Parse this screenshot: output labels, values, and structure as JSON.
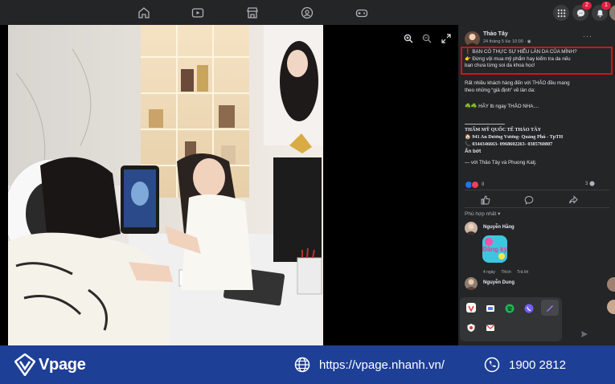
{
  "post": {
    "author": "Thảo Tây",
    "date": "24 tháng 5 lúc 10:00 · ",
    "more": "···",
    "highlight_lines": [
      "❗ BẠN CÓ THỰC SỰ HIỂU LÀN DA CỦA MÌNH?",
      "👉 Đừng vội mua mỹ phẩm hay kiểm tra da nếu",
      "bạn chưa từng soi da khoa học!"
    ],
    "body_lines": [
      "Rất nhiều khách hàng đến với THẢO đều mang",
      "theo những “giả định” về làn da:"
    ],
    "cta": "☘️☘️ HÃY Ib ngay THẢO NHA....",
    "contact_title": "THẨM MỸ QUỐC TẾ THẢO TÂY",
    "contact_address": "🏠 941 An Dương Vương- Quảng Phú - TpTH",
    "contact_phone": "📞 0344346663- 0968602263- 0385760807",
    "see_less": "Ẩn bớt",
    "tags": "— với Thảo Tây và Phuong Katj.",
    "reaction_count": "8",
    "comment_count": "3"
  },
  "comments": {
    "sort_label": "Phù hợp nhất ▾",
    "first": {
      "name": "Nguyễn Hằng",
      "sticker_text": "Đăng ký",
      "time": "4 ngày",
      "like": "Thích",
      "reply": "Trả lời"
    },
    "second": {
      "name": "Nguyễn Dung"
    }
  },
  "notifications": {
    "messenger_badge": "2",
    "bell_badge": "1"
  },
  "footer": {
    "brand": "Vpage",
    "url": "https://vpage.nhanh.vn/",
    "phone": "1900 2812"
  },
  "colors": {
    "footer_bg": "#1e3f96",
    "highlight_border": "#d1141a",
    "panel_bg": "#242526"
  }
}
